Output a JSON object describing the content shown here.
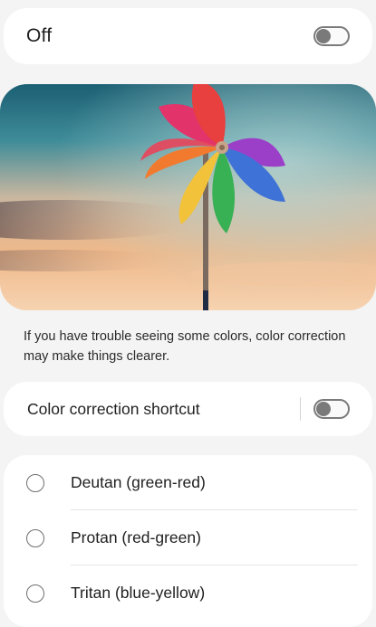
{
  "master": {
    "label": "Off",
    "toggle_state": "off"
  },
  "hero": {
    "image": "pinwheel-illustration"
  },
  "description": "If you have trouble seeing some colors, color correction may make things clearer.",
  "shortcut": {
    "label": "Color correction shortcut",
    "toggle_state": "off"
  },
  "options": [
    {
      "label": "Deutan (green-red)",
      "selected": false
    },
    {
      "label": "Protan (red-green)",
      "selected": false
    },
    {
      "label": "Tritan (blue-yellow)",
      "selected": false
    }
  ],
  "colors": {
    "background": "#f4f4f4",
    "card": "#ffffff",
    "toggle_off": "#7a7a7a"
  }
}
